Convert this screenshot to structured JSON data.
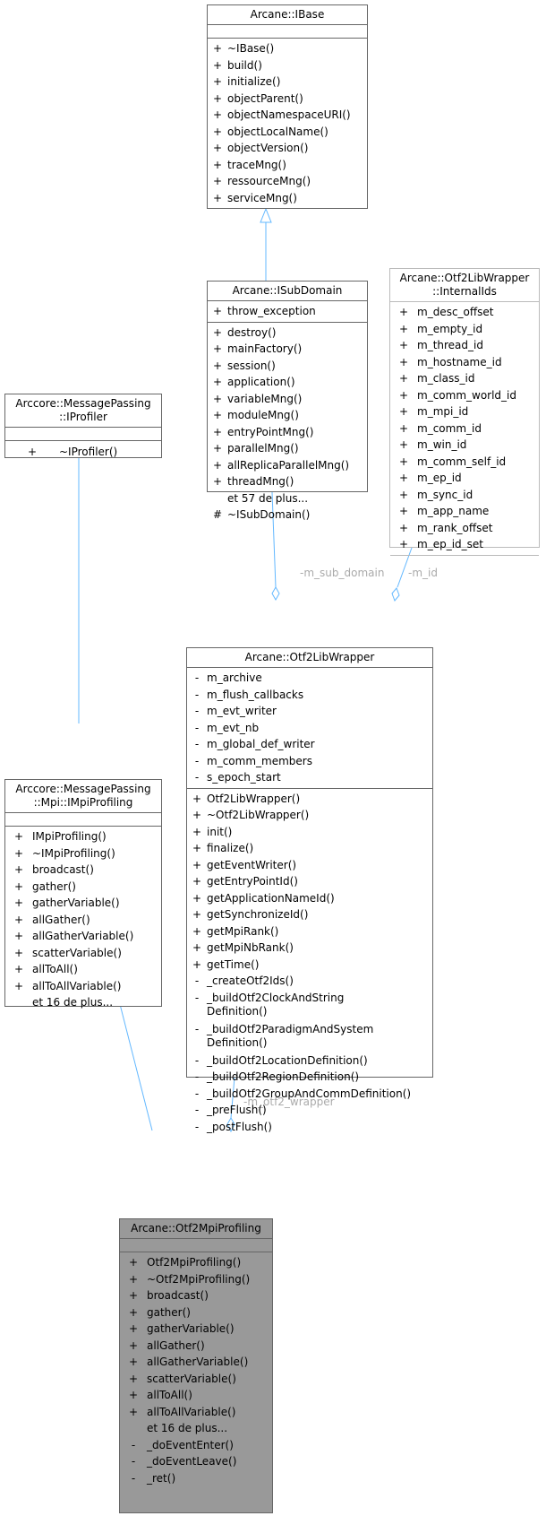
{
  "classes": {
    "ibase": {
      "title": "Arcane::IBase",
      "attributes": [],
      "methods": [
        {
          "vis": "+",
          "name": "~IBase()"
        },
        {
          "vis": "+",
          "name": "build()"
        },
        {
          "vis": "+",
          "name": "initialize()"
        },
        {
          "vis": "+",
          "name": "objectParent()"
        },
        {
          "vis": "+",
          "name": "objectNamespaceURI()"
        },
        {
          "vis": "+",
          "name": "objectLocalName()"
        },
        {
          "vis": "+",
          "name": "objectVersion()"
        },
        {
          "vis": "+",
          "name": "traceMng()"
        },
        {
          "vis": "+",
          "name": "ressourceMng()"
        },
        {
          "vis": "+",
          "name": "serviceMng()"
        }
      ]
    },
    "isubdomain": {
      "title": "Arcane::ISubDomain",
      "attributes": [
        {
          "vis": "+",
          "name": "throw_exception"
        }
      ],
      "methods": [
        {
          "vis": "+",
          "name": "destroy()"
        },
        {
          "vis": "+",
          "name": "mainFactory()"
        },
        {
          "vis": "+",
          "name": "session()"
        },
        {
          "vis": "+",
          "name": "application()"
        },
        {
          "vis": "+",
          "name": "variableMng()"
        },
        {
          "vis": "+",
          "name": "moduleMng()"
        },
        {
          "vis": "+",
          "name": "entryPointMng()"
        },
        {
          "vis": "+",
          "name": "parallelMng()"
        },
        {
          "vis": "+",
          "name": "allReplicaParallelMng()"
        },
        {
          "vis": "+",
          "name": "threadMng()"
        },
        {
          "vis": "",
          "name": "et 57 de plus..."
        },
        {
          "vis": "#",
          "name": "~ISubDomain()"
        }
      ]
    },
    "internalids": {
      "title_line1": "Arcane::Otf2LibWrapper",
      "title_line2": "::InternalIds",
      "attributes": [
        {
          "vis": "+",
          "name": "m_desc_offset"
        },
        {
          "vis": "+",
          "name": "m_empty_id"
        },
        {
          "vis": "+",
          "name": "m_thread_id"
        },
        {
          "vis": "+",
          "name": "m_hostname_id"
        },
        {
          "vis": "+",
          "name": "m_class_id"
        },
        {
          "vis": "+",
          "name": "m_comm_world_id"
        },
        {
          "vis": "+",
          "name": "m_mpi_id"
        },
        {
          "vis": "+",
          "name": "m_comm_id"
        },
        {
          "vis": "+",
          "name": "m_win_id"
        },
        {
          "vis": "+",
          "name": "m_comm_self_id"
        },
        {
          "vis": "+",
          "name": "m_ep_id"
        },
        {
          "vis": "+",
          "name": "m_sync_id"
        },
        {
          "vis": "+",
          "name": "m_app_name"
        },
        {
          "vis": "+",
          "name": "m_rank_offset"
        },
        {
          "vis": "+",
          "name": "m_ep_id_set"
        }
      ],
      "methods": []
    },
    "iprofiler": {
      "title_line1": "Arccore::MessagePassing",
      "title_line2": "::IProfiler",
      "attributes": [],
      "methods": [
        {
          "vis": "+",
          "name": "~IProfiler()"
        }
      ]
    },
    "impiprofiling": {
      "title_line1": "Arccore::MessagePassing",
      "title_line2": "::Mpi::IMpiProfiling",
      "attributes": [],
      "methods": [
        {
          "vis": "+",
          "name": "IMpiProfiling()"
        },
        {
          "vis": "+",
          "name": "~IMpiProfiling()"
        },
        {
          "vis": "+",
          "name": "broadcast()"
        },
        {
          "vis": "+",
          "name": "gather()"
        },
        {
          "vis": "+",
          "name": "gatherVariable()"
        },
        {
          "vis": "+",
          "name": "allGather()"
        },
        {
          "vis": "+",
          "name": "allGatherVariable()"
        },
        {
          "vis": "+",
          "name": "scatterVariable()"
        },
        {
          "vis": "+",
          "name": "allToAll()"
        },
        {
          "vis": "+",
          "name": "allToAllVariable()"
        },
        {
          "vis": "",
          "name": "et 16 de plus..."
        }
      ]
    },
    "otf2libwrapper": {
      "title": "Arcane::Otf2LibWrapper",
      "attributes": [
        {
          "vis": "-",
          "name": "m_archive"
        },
        {
          "vis": "-",
          "name": "m_flush_callbacks"
        },
        {
          "vis": "-",
          "name": "m_evt_writer"
        },
        {
          "vis": "-",
          "name": "m_evt_nb"
        },
        {
          "vis": "-",
          "name": "m_global_def_writer"
        },
        {
          "vis": "-",
          "name": "m_comm_members"
        },
        {
          "vis": "-",
          "name": "s_epoch_start"
        }
      ],
      "methods": [
        {
          "vis": "+",
          "name": "Otf2LibWrapper()"
        },
        {
          "vis": "+",
          "name": "~Otf2LibWrapper()"
        },
        {
          "vis": "+",
          "name": "init()"
        },
        {
          "vis": "+",
          "name": "finalize()"
        },
        {
          "vis": "+",
          "name": "getEventWriter()"
        },
        {
          "vis": "+",
          "name": "getEntryPointId()"
        },
        {
          "vis": "+",
          "name": "getApplicationNameId()"
        },
        {
          "vis": "+",
          "name": "getSynchronizeId()"
        },
        {
          "vis": "+",
          "name": "getMpiRank()"
        },
        {
          "vis": "+",
          "name": "getMpiNbRank()"
        },
        {
          "vis": "+",
          "name": "getTime()"
        },
        {
          "vis": "-",
          "name": "_createOtf2Ids()"
        },
        {
          "vis": "-",
          "name": "_buildOtf2ClockAndString",
          "name2": "Definition()"
        },
        {
          "vis": "-",
          "name": "_buildOtf2ParadigmAndSystem",
          "name2": "Definition()"
        },
        {
          "vis": "-",
          "name": "_buildOtf2LocationDefinition()"
        },
        {
          "vis": "-",
          "name": "_buildOtf2RegionDefinition()"
        },
        {
          "vis": "-",
          "name": "_buildOtf2GroupAndCommDefinition()"
        },
        {
          "vis": "-",
          "name": "_preFlush()"
        },
        {
          "vis": "-",
          "name": "_postFlush()"
        }
      ]
    },
    "otf2mpiprofiling": {
      "title": "Arcane::Otf2MpiProfiling",
      "attributes": [],
      "methods": [
        {
          "vis": "+",
          "name": "Otf2MpiProfiling()"
        },
        {
          "vis": "+",
          "name": "~Otf2MpiProfiling()"
        },
        {
          "vis": "+",
          "name": "broadcast()"
        },
        {
          "vis": "+",
          "name": "gather()"
        },
        {
          "vis": "+",
          "name": "gatherVariable()"
        },
        {
          "vis": "+",
          "name": "allGather()"
        },
        {
          "vis": "+",
          "name": "allGatherVariable()"
        },
        {
          "vis": "+",
          "name": "scatterVariable()"
        },
        {
          "vis": "+",
          "name": "allToAll()"
        },
        {
          "vis": "+",
          "name": "allToAllVariable()"
        },
        {
          "vis": "",
          "name": "et 16 de plus..."
        },
        {
          "vis": "-",
          "name": "_doEventEnter()"
        },
        {
          "vis": "-",
          "name": "_doEventLeave()"
        },
        {
          "vis": "-",
          "name": "_ret()"
        }
      ]
    }
  },
  "edge_labels": {
    "sub_domain": "-m_sub_domain",
    "id": "-m_id",
    "otf2_wrapper": "-m_otf2_wrapper"
  },
  "colors": {
    "edge": "#63b8ff",
    "focus_fill": "#999999",
    "border": "#666666",
    "grey_border": "#bbbbbb",
    "label": "#aaaaaa"
  }
}
